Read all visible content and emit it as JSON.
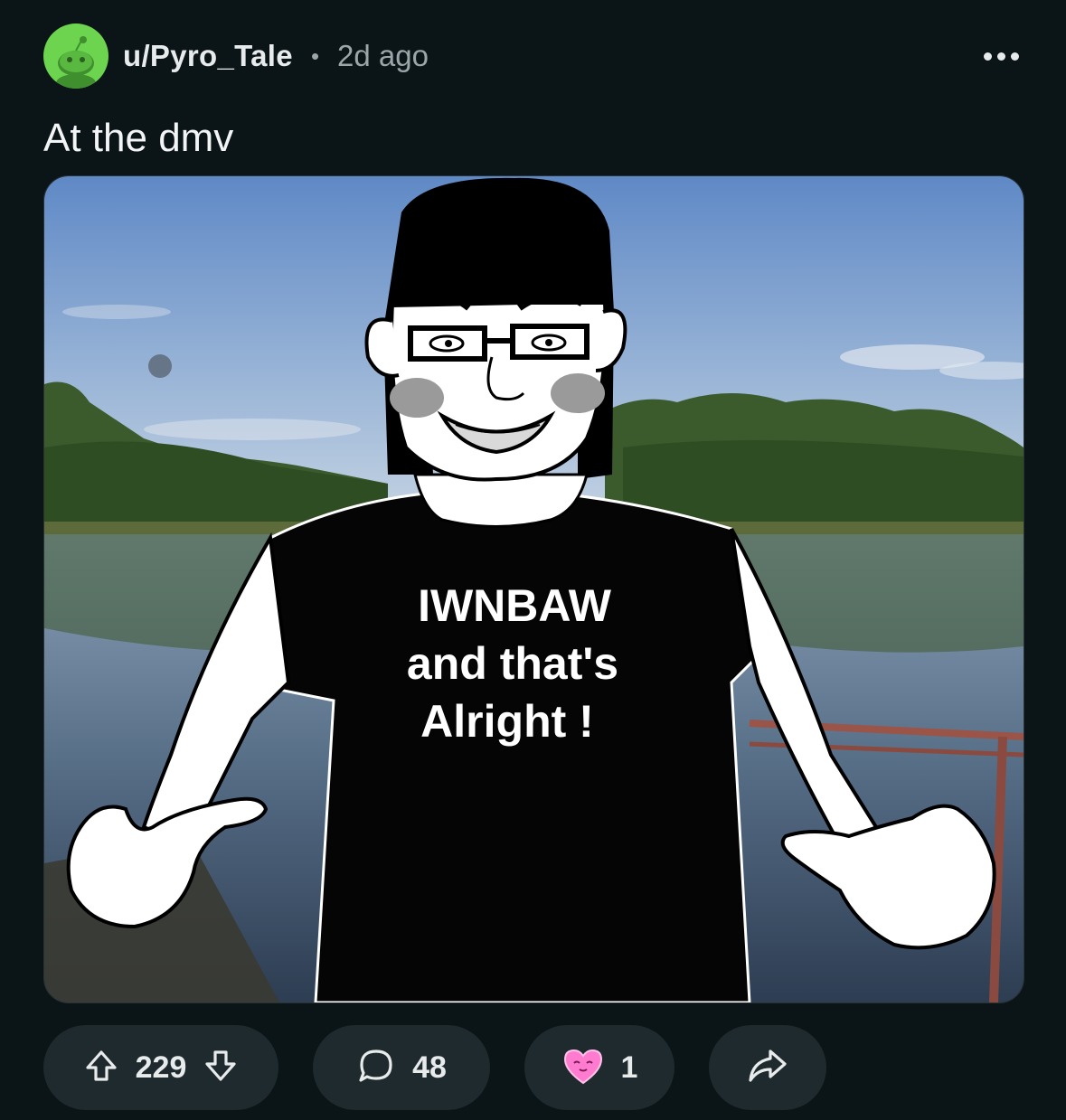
{
  "post": {
    "username": "u/Pyro_Tale",
    "separator": "•",
    "time": "2d ago",
    "title": "At the dmv"
  },
  "image": {
    "shirt_line1": "IWNBAW",
    "shirt_line2": "and that's",
    "shirt_line3": "Alright !"
  },
  "actions": {
    "upvotes": "229",
    "comments": "48",
    "awards": "1"
  },
  "icons": {
    "avatar": "snoo-avatar-icon",
    "more": "more-options-icon",
    "upvote": "upvote-arrow-icon",
    "downvote": "downvote-arrow-icon",
    "comment": "comment-bubble-icon",
    "award": "heart-award-icon",
    "share": "share-arrow-icon"
  },
  "colors": {
    "background": "#0b1416",
    "pill": "#1f2a2e",
    "avatar": "#6cd44e",
    "award": "#ff7bd0"
  }
}
